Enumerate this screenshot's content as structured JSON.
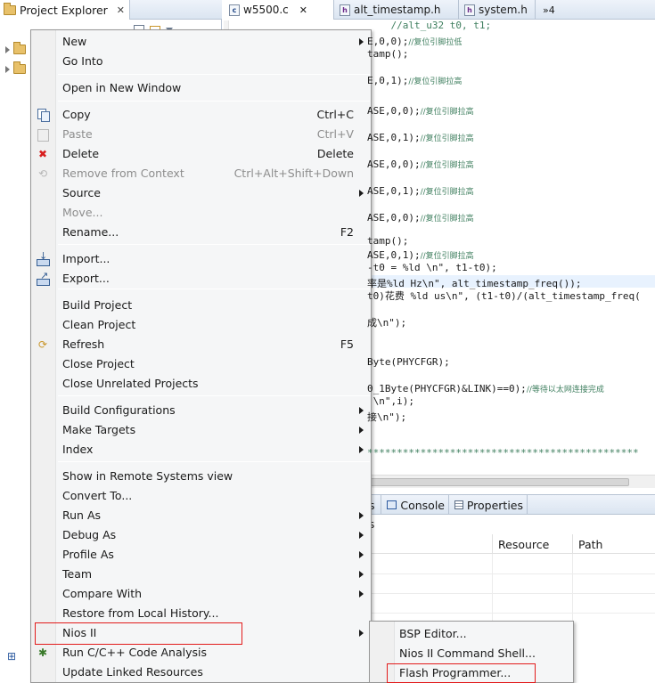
{
  "project_explorer": {
    "tab_label": "Project Explorer",
    "close_glyph": "✕"
  },
  "editor": {
    "tabs": [
      {
        "label": "w5500.c",
        "close_glyph": "✕",
        "active": true,
        "icon": "c-file-icon"
      },
      {
        "label": "alt_timestamp.h",
        "active": false,
        "icon": "h-file-icon"
      },
      {
        "label": "system.h",
        "active": false,
        "icon": "h-file-icon"
      },
      {
        "label": "»4",
        "active": false
      }
    ],
    "code_lines": [
      {
        "code": "    //alt_u32 t0, t1;",
        "comment": ""
      },
      {
        "code": "E,0,0);",
        "comment": "//复位引脚拉低"
      },
      {
        "code": "tamp();",
        "comment": ""
      },
      {
        "code": "E,0,1);",
        "comment": "//复位引脚拉高"
      },
      {
        "code": "ASE,0,0);",
        "comment": "//复位引脚拉高"
      },
      {
        "code": "ASE,0,1);",
        "comment": "//复位引脚拉高"
      },
      {
        "code": "ASE,0,0);",
        "comment": "//复位引脚拉高"
      },
      {
        "code": "ASE,0,1);",
        "comment": "//复位引脚拉高"
      },
      {
        "code": "ASE,0,0);",
        "comment": "//复位引脚拉高"
      },
      {
        "code": "tamp();",
        "comment": ""
      },
      {
        "code": "ASE,0,1);",
        "comment": "//复位引脚拉高"
      },
      {
        "code": "-t0 = %ld \\n\", t1-t0);",
        "comment": ""
      },
      {
        "code": "率是%ld Hz\\n\", alt_timestamp_freq());",
        "comment": ""
      },
      {
        "code": "t0)花费 %ld us\\n\", (t1-t0)/(alt_timestamp_freq(",
        "comment": ""
      },
      {
        "code": "成\\n\");",
        "comment": ""
      },
      {
        "code": "Byte(PHYCFGR);",
        "comment": ""
      },
      {
        "code": "0_1Byte(PHYCFGR)&LINK)==0);",
        "comment": "//等待以太网连接完成"
      },
      {
        "code": " \\n\",i);",
        "comment": ""
      },
      {
        "code": "接\\n\");",
        "comment": ""
      },
      {
        "code": "**********************************************",
        "comment": ""
      }
    ]
  },
  "bottom_panel": {
    "tabs": [
      {
        "label": "s",
        "active": false
      },
      {
        "label": "Console",
        "active": false,
        "icon": "console-icon"
      },
      {
        "label": "Properties",
        "active": false,
        "icon": "properties-icon"
      }
    ],
    "subtitle": "s",
    "columns": [
      "Resource",
      "Path"
    ]
  },
  "context_menu": {
    "items": [
      {
        "label": "New",
        "shortcut": "",
        "submenu": true
      },
      {
        "label": "Go Into",
        "shortcut": ""
      },
      {
        "label": "Open in New Window",
        "shortcut": ""
      },
      {
        "label": "Copy",
        "shortcut": "Ctrl+C",
        "icon": "copy-icon"
      },
      {
        "label": "Paste",
        "shortcut": "Ctrl+V",
        "icon": "paste-icon",
        "disabled": true
      },
      {
        "label": "Delete",
        "shortcut": "Delete",
        "icon": "delete-icon"
      },
      {
        "label": "Remove from Context",
        "shortcut": "Ctrl+Alt+Shift+Down",
        "icon": "remove-context-icon",
        "disabled": true
      },
      {
        "label": "Source",
        "shortcut": "",
        "submenu": true
      },
      {
        "label": "Move...",
        "shortcut": "",
        "disabled": true
      },
      {
        "label": "Rename...",
        "shortcut": "F2"
      },
      {
        "label": "Import...",
        "shortcut": "",
        "icon": "import-icon"
      },
      {
        "label": "Export...",
        "shortcut": "",
        "icon": "export-icon"
      },
      {
        "label": "Build Project",
        "shortcut": ""
      },
      {
        "label": "Clean Project",
        "shortcut": ""
      },
      {
        "label": "Refresh",
        "shortcut": "F5",
        "icon": "refresh-icon"
      },
      {
        "label": "Close Project",
        "shortcut": ""
      },
      {
        "label": "Close Unrelated Projects",
        "shortcut": ""
      },
      {
        "label": "Build Configurations",
        "shortcut": "",
        "submenu": true
      },
      {
        "label": "Make Targets",
        "shortcut": "",
        "submenu": true
      },
      {
        "label": "Index",
        "shortcut": "",
        "submenu": true
      },
      {
        "label": "Show in Remote Systems view",
        "shortcut": ""
      },
      {
        "label": "Convert To...",
        "shortcut": ""
      },
      {
        "label": "Run As",
        "shortcut": "",
        "submenu": true
      },
      {
        "label": "Debug As",
        "shortcut": "",
        "submenu": true
      },
      {
        "label": "Profile As",
        "shortcut": "",
        "submenu": true
      },
      {
        "label": "Team",
        "shortcut": "",
        "submenu": true
      },
      {
        "label": "Compare With",
        "shortcut": "",
        "submenu": true
      },
      {
        "label": "Restore from Local History...",
        "shortcut": ""
      },
      {
        "label": "Nios II",
        "shortcut": "",
        "submenu": true,
        "highlighted": true
      },
      {
        "label": "Run C/C++ Code Analysis",
        "shortcut": "",
        "icon": "code-analysis-icon"
      },
      {
        "label": "Update Linked Resources",
        "shortcut": ""
      }
    ]
  },
  "nios_submenu": {
    "items": [
      {
        "label": "BSP Editor..."
      },
      {
        "label": "Nios II Command Shell..."
      },
      {
        "label": "Flash Programmer...",
        "highlighted": true
      }
    ]
  },
  "colors": {
    "annotation_red": "#e21b1b",
    "menu_bg": "#f5f6f7",
    "comment_green": "#3f7f5f",
    "string_blue": "#2a00ff"
  }
}
